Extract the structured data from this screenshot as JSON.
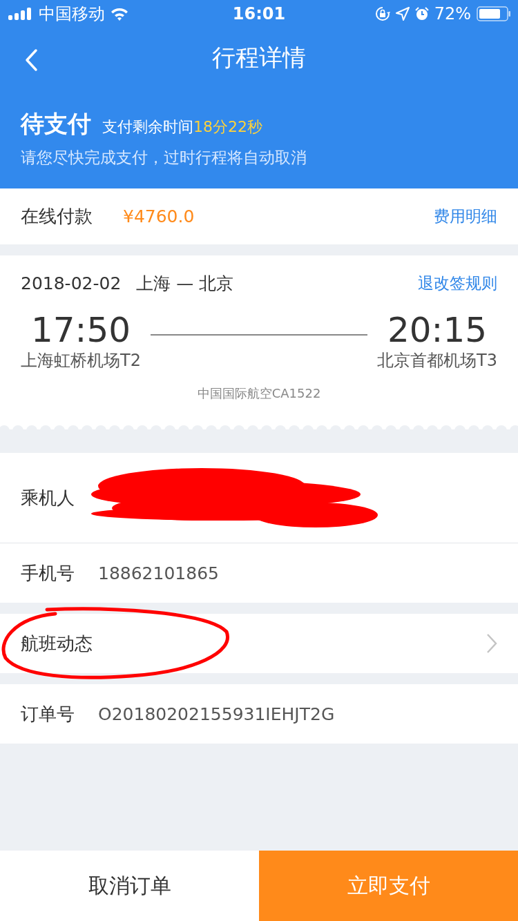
{
  "status_bar": {
    "carrier": "中国移动",
    "time": "16:01",
    "battery": "72%"
  },
  "nav": {
    "title": "行程详情"
  },
  "payment_status": {
    "status": "待支付",
    "countdown_label": "支付剩余时间",
    "countdown": "18分22秒",
    "notice": "请您尽快完成支付，过时行程将自动取消"
  },
  "online_payment": {
    "label": "在线付款",
    "amount": "¥4760.0",
    "link": "费用明细"
  },
  "flight": {
    "date": "2018-02-02",
    "route": "上海 — 北京",
    "rules_link": "退改签规则",
    "departure_time": "17:50",
    "departure_airport": "上海虹桥机场T2",
    "arrival_time": "20:15",
    "arrival_airport": "北京首都机场T3",
    "airline_flight": "中国国际航空CA1522"
  },
  "details": [
    {
      "label": "乘机人",
      "kind": "redacted"
    },
    {
      "label": "手机号",
      "kind": "text",
      "value": "18862101865"
    },
    {
      "label": "航班动态",
      "kind": "link",
      "circled": true
    },
    {
      "label": "订单号",
      "kind": "text",
      "value": "O20180202155931IEHJT2G"
    }
  ],
  "buttons": {
    "cancel": "取消订单",
    "pay": "立即支付"
  }
}
